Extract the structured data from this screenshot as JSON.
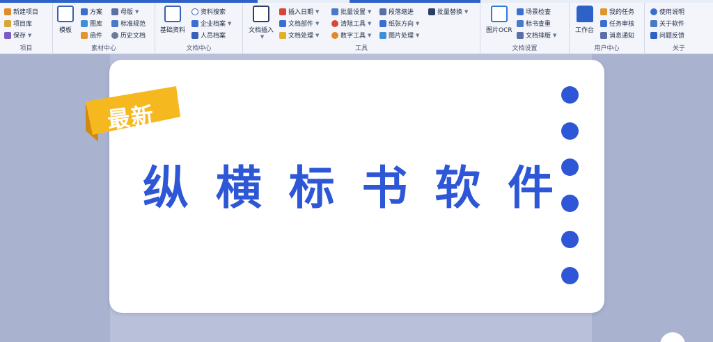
{
  "ribbon": {
    "groups": [
      {
        "label": "项目",
        "items": [
          "新建项目",
          "项目库",
          "保存"
        ]
      },
      {
        "label": "素材中心",
        "big": "模板",
        "items": [
          "方案",
          "图库",
          "函件",
          "母版",
          "标准规范",
          "历史文档"
        ]
      },
      {
        "label": "文档中心",
        "big": "基础资料",
        "items": [
          "资料搜索",
          "企业档案",
          "人员档案"
        ]
      },
      {
        "label": "工具",
        "big": "文档插入",
        "items": [
          "插入日期",
          "文档部件",
          "文档处理",
          "批量设置",
          "清除工具",
          "数字工具",
          "段落缩进",
          "纸张方向",
          "图片处理",
          "批量替换"
        ]
      },
      {
        "label": "文档设置",
        "big": "图片OCR",
        "items": [
          "场景检查",
          "标书查重",
          "文档排版"
        ]
      },
      {
        "label": "用户中心",
        "big": "工作台",
        "items": [
          "我的任务",
          "任务审核",
          "消息通知"
        ]
      },
      {
        "label": "关于",
        "items": [
          "使用说明",
          "关于软件",
          "问题反馈"
        ]
      }
    ]
  },
  "banner": {
    "tag": "最新",
    "title_chars": [
      "纵",
      "横",
      "标",
      "书",
      "软",
      "件"
    ],
    "dot_count": 6,
    "colors": {
      "accent": "#2d57d6",
      "tag": "#f6b81f",
      "tag_shadow": "#d08a12"
    }
  }
}
